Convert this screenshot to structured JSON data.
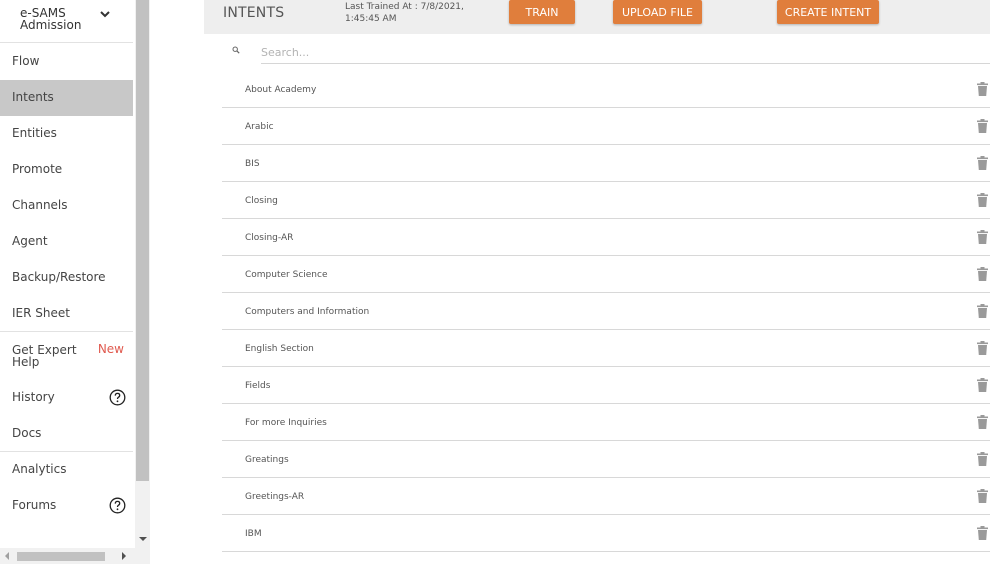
{
  "sidebar": {
    "bot_name": "e-SAMS Admission",
    "items": [
      {
        "label": "Flow"
      },
      {
        "label": "Intents"
      },
      {
        "label": "Entities"
      },
      {
        "label": "Promote"
      },
      {
        "label": "Channels"
      },
      {
        "label": "Agent"
      },
      {
        "label": "Backup/Restore"
      },
      {
        "label": "IER Sheet"
      },
      {
        "label": "Get Expert Help",
        "badge": "New"
      },
      {
        "label": "History"
      },
      {
        "label": "Docs"
      },
      {
        "label": "Analytics"
      },
      {
        "label": "Forums"
      }
    ],
    "active": "Intents"
  },
  "header": {
    "title": "INTENTS",
    "last_trained": "Last Trained At : 7/8/2021, 1:45:45 AM",
    "train_label": "TRAIN",
    "upload_label": "UPLOAD FILE",
    "create_label": "CREATE INTENT"
  },
  "search": {
    "placeholder": "Search..."
  },
  "intents": [
    "About Academy",
    "Arabic",
    "BIS",
    "Closing",
    "Closing-AR",
    "Computer Science",
    "Computers and Information",
    "English Section",
    "Fields",
    "For more Inquiries",
    "Greatings",
    "Greetings-AR",
    "IBM"
  ],
  "icons": {
    "trash": "trash-icon",
    "search": "search-icon",
    "help": "help-circle-icon",
    "chevron": "chevron-down-icon"
  },
  "colors": {
    "accent": "#e07e3c",
    "active_item": "#c8c8c8",
    "new_badge": "#e05a4f",
    "topbar": "#eeeeee"
  }
}
